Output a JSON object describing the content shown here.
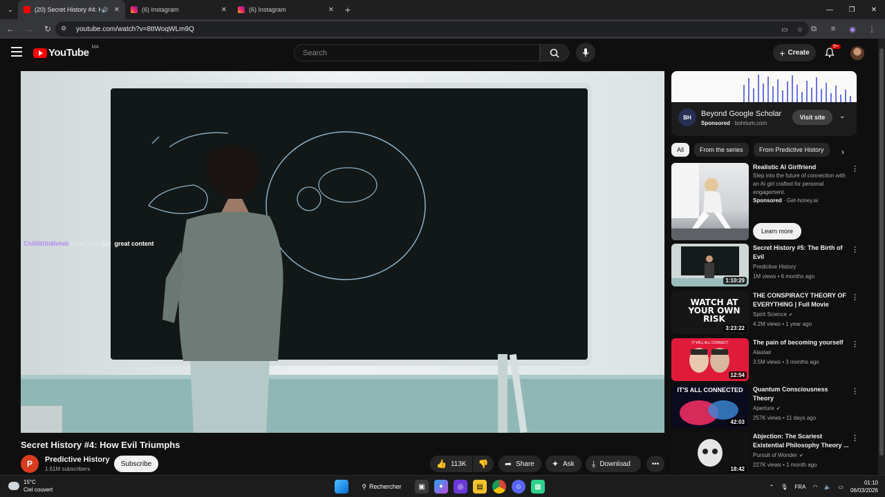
{
  "browser": {
    "tabs": [
      {
        "title": "(20) Secret History #4: How",
        "active": true,
        "favicon": "youtube-icon"
      },
      {
        "title": "(6) Instagram",
        "active": false,
        "favicon": "instagram-icon"
      },
      {
        "title": "(6) Instagram",
        "active": false,
        "favicon": "instagram-icon"
      }
    ],
    "url": "youtube.com/watch?v=8tIWoqWLm9Q"
  },
  "youtube": {
    "logo_text": "YouTube",
    "country_code": "MA",
    "search_placeholder": "Search",
    "create_label": "Create",
    "notification_badge": "9+"
  },
  "video": {
    "chat_user": "ChillWithMehdi",
    "chat_faded": "Love this guy",
    "chat_message": "great content",
    "title": "Secret History #4: How Evil Triumphs",
    "channel_name": "Predictive History",
    "channel_initial": "P",
    "subscribers": "1.61M subscribers",
    "subscribe_label": "Subscribe",
    "likes": "113K",
    "share_label": "Share",
    "ask_label": "Ask",
    "download_label": "Download"
  },
  "ad": {
    "logo_text": "BH",
    "title": "Beyond Google Scholar",
    "sponsored": "Sponsored",
    "domain": "bohrium.com",
    "button": "Visit site"
  },
  "chips": [
    "All",
    "From the series",
    "From Predictive History"
  ],
  "recommendations": [
    {
      "title": "Realistic AI Girlfriend",
      "desc": "Step into the future of connection with an AI girl crafted for personal engagement.",
      "sponsored": "Sponsored",
      "domain": "Get-honey.ai",
      "button": "Learn more"
    },
    {
      "title": "Secret History #5:  The Birth of Evil",
      "channel": "Predictive History",
      "meta": "1M views • 6 months ago",
      "duration": "1:10:29"
    },
    {
      "title": "THE CONSPIRACY THEORY OF EVERYTHING | Full Movie",
      "channel": "Spirit Science",
      "meta": "4.2M views • 1 year ago",
      "duration": "3:23:22",
      "thumb_text": "WATCH AT YOUR OWN RISK"
    },
    {
      "title": "The pain of becoming yourself",
      "channel": "Alastair",
      "meta": "3.5M views • 3 months ago",
      "duration": "12:54",
      "thumb_text": "IT WILL ALL CONNECT"
    },
    {
      "title": "Quantum Consciousness Theory",
      "channel": "Aperture",
      "meta": "257K views • 11 days ago",
      "duration": "42:03",
      "thumb_text": "IT'S ALL CONNECTED"
    },
    {
      "title": "Abjection: The Scariest Existential Philosophy Theory ...",
      "channel": "Pursuit of Wonder",
      "meta": "227K views • 1 month ago",
      "duration": "18:42"
    }
  ],
  "taskbar": {
    "temperature": "15°C",
    "weather": "Ciel couvert",
    "search_label": "Rechercher",
    "language": "FRA",
    "time": "01:10",
    "date": "06/03/2026"
  }
}
